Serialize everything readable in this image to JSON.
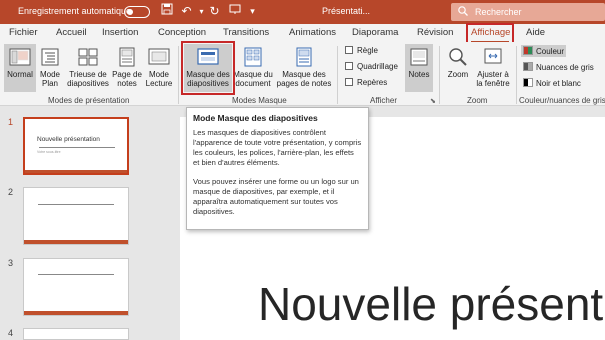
{
  "titlebar": {
    "autosave_label": "Enregistrement automatique",
    "toggle_state": "Non",
    "doc_title": "Présentati...",
    "search_placeholder": "Rechercher"
  },
  "tabs": [
    {
      "label": "Fichier"
    },
    {
      "label": "Accueil"
    },
    {
      "label": "Insertion"
    },
    {
      "label": "Conception"
    },
    {
      "label": "Transitions"
    },
    {
      "label": "Animations"
    },
    {
      "label": "Diaporama"
    },
    {
      "label": "Révision"
    },
    {
      "label": "Affichage",
      "active": true
    },
    {
      "label": "Aide"
    }
  ],
  "ribbon": {
    "modes_presentation": {
      "label": "Modes de présentation",
      "buttons": [
        {
          "line1": "Normal",
          "line2": ""
        },
        {
          "line1": "Mode",
          "line2": "Plan"
        },
        {
          "line1": "Trieuse de",
          "line2": "diapositives"
        },
        {
          "line1": "Page de",
          "line2": "notes"
        },
        {
          "line1": "Mode",
          "line2": "Lecture"
        }
      ]
    },
    "modes_masque": {
      "label": "Modes Masque",
      "buttons": [
        {
          "line1": "Masque des",
          "line2": "diapositives"
        },
        {
          "line1": "Masque du",
          "line2": "document"
        },
        {
          "line1": "Masque des",
          "line2": "pages de notes"
        }
      ]
    },
    "afficher": {
      "label": "Afficher",
      "checks": [
        "Règle",
        "Quadrillage",
        "Repères"
      ],
      "notes_label": "Notes"
    },
    "zoom": {
      "label": "Zoom",
      "zoom_label": "Zoom",
      "fit_line1": "Ajuster à",
      "fit_line2": "la fenêtre"
    },
    "couleur": {
      "label": "Couleur/nuances de gris",
      "options": [
        "Couleur",
        "Nuances de gris",
        "Noir et blanc"
      ]
    }
  },
  "tooltip": {
    "title": "Mode Masque des diapositives",
    "para1": "Les masques de diapositives contrôlent l'apparence de toute votre présentation, y compris les couleurs, les polices, l'arrière-plan, les effets et bien d'autres éléments.",
    "para2": "Vous pouvez insérer une forme ou un logo sur un masque de diapositives, par exemple, et il apparaîtra automatiquement sur toutes vos diapositives."
  },
  "slides": [
    {
      "number": "1",
      "title": "Nouvelle présentation",
      "subtitle": "Votre sous-titre"
    },
    {
      "number": "2"
    },
    {
      "number": "3"
    },
    {
      "number": "4"
    }
  ],
  "main_slide": {
    "title": "Nouvelle présent"
  },
  "colors": {
    "accent": "#b7472a",
    "highlight": "#c62828"
  }
}
